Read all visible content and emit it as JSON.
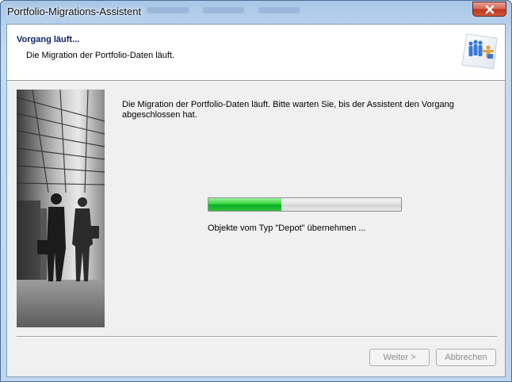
{
  "window": {
    "title": "Portfolio-Migrations-Assistent"
  },
  "header": {
    "title": "Vorgang läuft...",
    "subtitle": "Die Migration der Portfolio-Daten läuft.",
    "icon": "people-group-icon"
  },
  "main": {
    "info_text": "Die Migration der Portfolio-Daten läuft. Bitte warten Sie, bis der Assistent den Vorgang abgeschlossen hat.",
    "progress_fraction": 0.38,
    "status_text": "Objekte vom Typ \"Depot\" übernehmen ..."
  },
  "footer": {
    "next_label": "Weiter >",
    "cancel_label": "Abbrechen"
  },
  "colors": {
    "progress_fill": "#06b025",
    "header_title": "#12246b",
    "close_button": "#c2361c"
  }
}
